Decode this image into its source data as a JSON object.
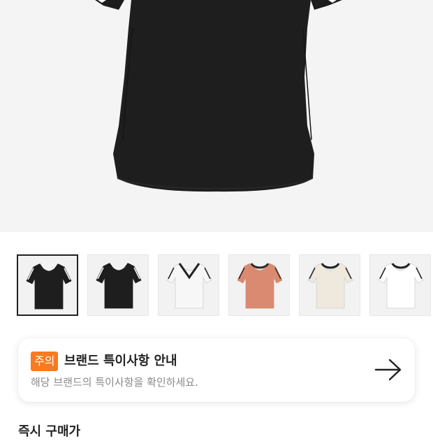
{
  "product": {
    "main_image": "black-v-neck-tshirt",
    "thumbnails": [
      {
        "name": "thumb-black-vneck-front",
        "color": "#1e1e1e",
        "trim": "#1e1e1e",
        "stripes": "#ffffff",
        "neck": "v",
        "selected": true
      },
      {
        "name": "thumb-black-vneck-back",
        "color": "#1e1e1e",
        "trim": "#1e1e1e",
        "stripes": "#ffffff",
        "neck": "v",
        "selected": false
      },
      {
        "name": "thumb-white-vneck",
        "color": "#f7f7f7",
        "trim": "#222222",
        "stripes": "#222222",
        "neck": "v",
        "selected": false
      },
      {
        "name": "thumb-pink-crew",
        "color": "#d98a70",
        "trim": "#2a2a2a",
        "stripes": "#2a2a2a",
        "neck": "crew",
        "selected": false
      },
      {
        "name": "thumb-cream-crew",
        "color": "#efe9dd",
        "trim": "#222222",
        "stripes": "#222222",
        "neck": "crew",
        "selected": false
      },
      {
        "name": "thumb-white-crew",
        "color": "#ffffff",
        "trim": "#222222",
        "stripes": "#222222",
        "neck": "crew",
        "selected": false
      }
    ]
  },
  "notice": {
    "badge": "주의",
    "title": "브랜드 특이사항 안내",
    "subtitle": "해당 브랜드의 특이사항을 확인하세요.",
    "arrow_icon": "arrow-right-icon",
    "badge_color": "#fa7a1e"
  },
  "section": {
    "title": "즉시 구매가"
  }
}
